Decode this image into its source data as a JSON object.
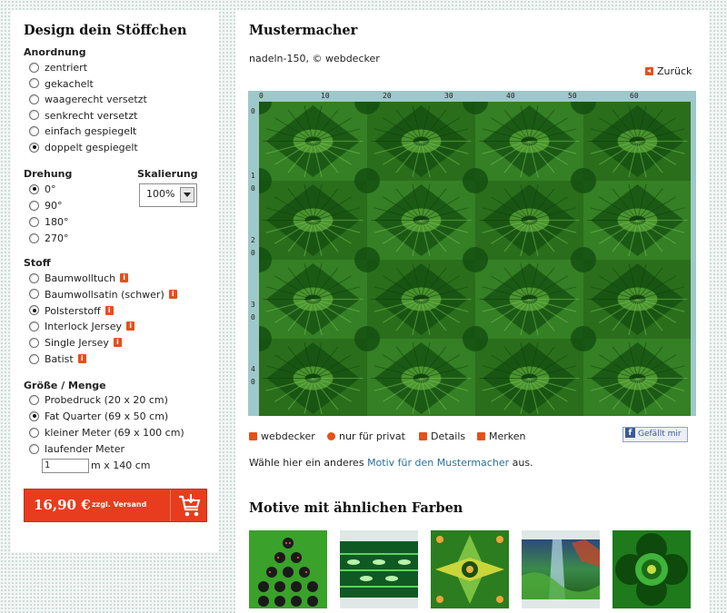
{
  "sidebar": {
    "title": "Design dein Stöffchen",
    "arrangement": {
      "heading": "Anordnung",
      "options": [
        {
          "label": "zentriert",
          "selected": false
        },
        {
          "label": "gekachelt",
          "selected": false
        },
        {
          "label": "waagerecht versetzt",
          "selected": false
        },
        {
          "label": "senkrecht versetzt",
          "selected": false
        },
        {
          "label": "einfach gespiegelt",
          "selected": false
        },
        {
          "label": "doppelt gespiegelt",
          "selected": true
        }
      ]
    },
    "rotation": {
      "heading": "Drehung",
      "options": [
        {
          "label": "0°",
          "selected": true
        },
        {
          "label": "90°",
          "selected": false
        },
        {
          "label": "180°",
          "selected": false
        },
        {
          "label": "270°",
          "selected": false
        }
      ]
    },
    "scaling": {
      "heading": "Skalierung",
      "value": "100%"
    },
    "fabric": {
      "heading": "Stoff",
      "options": [
        {
          "label": "Baumwolltuch",
          "selected": false,
          "info": "i"
        },
        {
          "label": "Baumwollsatin (schwer)",
          "selected": false,
          "info": "i"
        },
        {
          "label": "Polsterstoff",
          "selected": true,
          "info": "i"
        },
        {
          "label": "Interlock Jersey",
          "selected": false,
          "info": "i"
        },
        {
          "label": "Single Jersey",
          "selected": false,
          "info": "i"
        },
        {
          "label": "Batist",
          "selected": false,
          "info": "i"
        }
      ]
    },
    "size": {
      "heading": "Größe / Menge",
      "options": [
        {
          "label": "Probedruck (20 x 20 cm)",
          "selected": false
        },
        {
          "label": "Fat Quarter (69 x 50 cm)",
          "selected": true
        },
        {
          "label": "kleiner Meter (69 x 100 cm)",
          "selected": false
        },
        {
          "label": "laufender Meter",
          "selected": false
        }
      ],
      "meter_value": "1",
      "meter_unit": "m x 140 cm"
    },
    "buy": {
      "price": "16,90 €",
      "shipping": "zzgl. Versand"
    }
  },
  "main": {
    "title": "Mustermacher",
    "subtitle": "nadeln-150, © webdecker",
    "back_label": "Zurück",
    "ruler": {
      "top_ticks": [
        "0",
        "10",
        "20",
        "30",
        "40",
        "50",
        "60"
      ],
      "left_ticks": [
        "0",
        "10",
        "20",
        "30",
        "40"
      ]
    },
    "actions": {
      "author": "webdecker",
      "private": "nur für privat",
      "details": "Details",
      "bookmark": "Merken",
      "like": "Gefällt mir"
    },
    "choose": {
      "prefix": "Wähle hier ein anderes ",
      "link": "Motiv für den Mustermacher",
      "suffix": " aus."
    },
    "similar_heading": "Motive mit ähnlichen Farben"
  },
  "colors": {
    "accent": "#e4501b",
    "buy_button": "#e83c1e",
    "link": "#2a6f9b",
    "preview_frame": "#9ec8c9",
    "fabric_dark": "#134d10",
    "fabric_light": "#5fae3a"
  },
  "icons": {
    "back": "arrow-left-icon",
    "info": "info-icon",
    "cart": "cart-icon",
    "author": "user-icon",
    "private": "private-use-icon",
    "details": "info-icon",
    "bookmark": "check-icon",
    "like": "facebook-icon"
  }
}
